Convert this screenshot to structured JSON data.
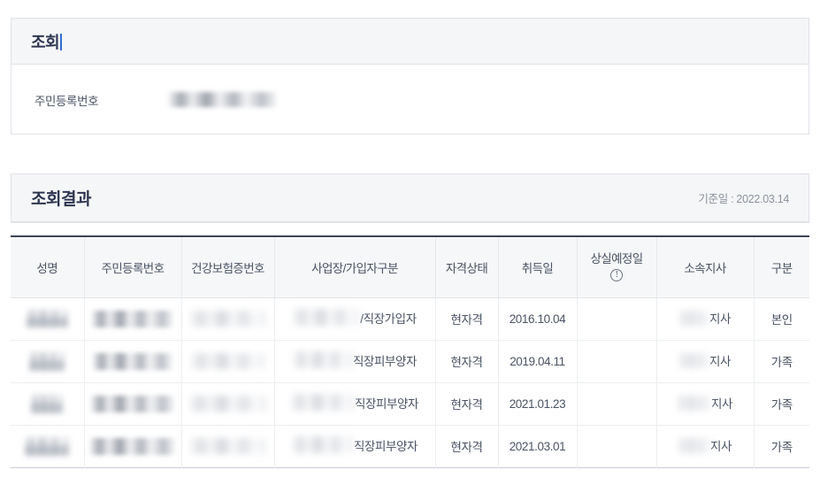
{
  "search_panel": {
    "title": "조회",
    "has_caret": true,
    "field_label": "주민등록번호",
    "field_value_redacted": true
  },
  "result_panel": {
    "title": "조회결과",
    "meta": "기준일 : 2022.03.14"
  },
  "table": {
    "columns": [
      {
        "label": "성명",
        "icon": null
      },
      {
        "label": "주민등록번호",
        "icon": null
      },
      {
        "label": "건강보험증번호",
        "icon": null
      },
      {
        "label": "사업장/가입자구분",
        "icon": null
      },
      {
        "label": "자격상태",
        "icon": null
      },
      {
        "label": "취득일",
        "icon": null
      },
      {
        "label": "상실예정일",
        "icon": "info-exclamation-icon"
      },
      {
        "label": "소속지사",
        "icon": null
      },
      {
        "label": "구분",
        "icon": null
      }
    ],
    "rows": [
      {
        "name_redacted": true,
        "rrn_redacted": true,
        "card_no_redacted": true,
        "workplace_redacted": true,
        "workplace_suffix": "/직장가입자",
        "status": "현자격",
        "acquired_date": "2016.10.04",
        "expected_loss_date": "",
        "branch_redacted": true,
        "branch_suffix": "지사",
        "relation": "본인"
      },
      {
        "name_redacted": true,
        "rrn_redacted": true,
        "card_no_redacted": true,
        "workplace_redacted": true,
        "workplace_suffix": "직장피부양자",
        "status": "현자격",
        "acquired_date": "2019.04.11",
        "expected_loss_date": "",
        "branch_redacted": true,
        "branch_suffix": "지사",
        "relation": "가족"
      },
      {
        "name_redacted": true,
        "rrn_redacted": true,
        "card_no_redacted": true,
        "workplace_redacted": true,
        "workplace_suffix": "직장피부양자",
        "status": "현자격",
        "acquired_date": "2021.01.23",
        "expected_loss_date": "",
        "branch_redacted": true,
        "branch_suffix": "지사",
        "relation": "가족"
      },
      {
        "name_redacted": true,
        "rrn_redacted": true,
        "card_no_redacted": true,
        "workplace_redacted": true,
        "workplace_suffix": "직장피부양자",
        "status": "현자격",
        "acquired_date": "2021.03.01",
        "expected_loss_date": "",
        "branch_redacted": true,
        "branch_suffix": "지사",
        "relation": "가족"
      }
    ]
  },
  "colors": {
    "title": "#2d3550",
    "text": "#4a5263",
    "muted": "#8b919d",
    "panel_head_bg": "#f5f6f7",
    "table_top_border": "#3c4457",
    "caret": "#2f6fd0"
  }
}
